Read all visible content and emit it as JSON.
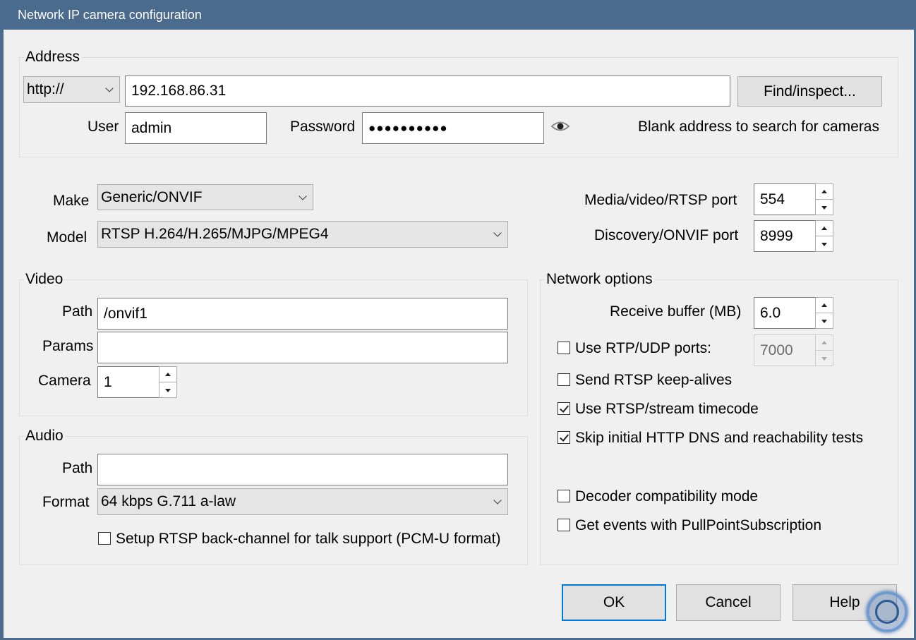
{
  "window": {
    "title": "Network IP camera configuration"
  },
  "address": {
    "legend": "Address",
    "protocol": "http://",
    "host": "192.168.86.31",
    "find_button": "Find/inspect...",
    "user_label": "User",
    "user": "admin",
    "password_label": "Password",
    "password_masked": "●●●●●●●●●●",
    "hint": "Blank address to search for cameras"
  },
  "device": {
    "make_label": "Make",
    "make": "Generic/ONVIF",
    "model_label": "Model",
    "model": "RTSP H.264/H.265/MJPG/MPEG4",
    "media_port_label": "Media/video/RTSP port",
    "media_port": "554",
    "discovery_port_label": "Discovery/ONVIF port",
    "discovery_port": "8999"
  },
  "video": {
    "legend": "Video",
    "path_label": "Path",
    "path": "/onvif1",
    "params_label": "Params",
    "params": "",
    "camera_label": "Camera",
    "camera": "1"
  },
  "audio": {
    "legend": "Audio",
    "path_label": "Path",
    "path": "",
    "format_label": "Format",
    "format": "64 kbps G.711 a-law",
    "backchannel_label": "Setup RTSP back-channel for talk support (PCM-U format)",
    "backchannel_checked": false
  },
  "network": {
    "legend": "Network options",
    "receive_buffer_label": "Receive buffer (MB)",
    "receive_buffer": "6.0",
    "rtp_udp_label": "Use RTP/UDP ports:",
    "rtp_udp_checked": false,
    "rtp_udp_port": "7000",
    "keepalive_label": "Send RTSP keep-alives",
    "keepalive_checked": false,
    "timecode_label": "Use RTSP/stream timecode",
    "timecode_checked": true,
    "skip_tests_label": "Skip initial HTTP DNS and reachability tests",
    "skip_tests_checked": true,
    "decoder_compat_label": "Decoder compatibility mode",
    "decoder_compat_checked": false,
    "pullpoint_label": "Get events with PullPointSubscription",
    "pullpoint_checked": false
  },
  "buttons": {
    "ok": "OK",
    "cancel": "Cancel",
    "help": "Help"
  },
  "colors": {
    "titlebar": "#4a6a8e",
    "default_button_border": "#0078d7",
    "dialog_bg": "#f0f0f0"
  }
}
